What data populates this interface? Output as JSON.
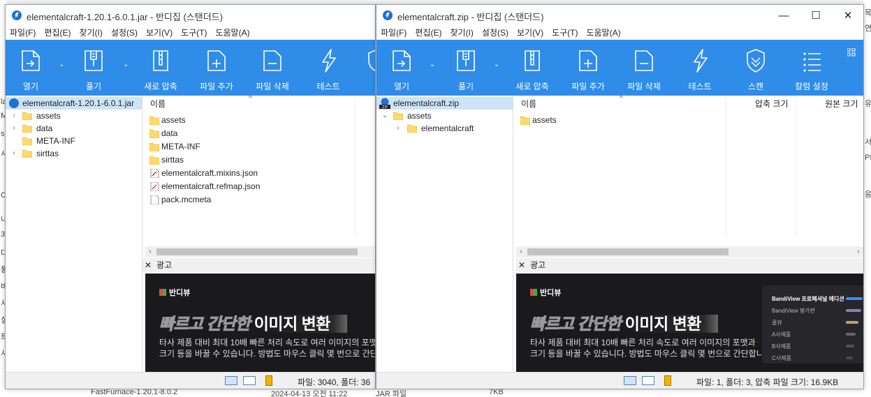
{
  "background": {
    "left_chars": [
      "la",
      "M",
      "s",
      "사",
      "Or",
      "내",
      "3",
      "다",
      "통",
      "바",
      "사",
      "실",
      "트",
      "사"
    ],
    "right_chars": [
      "목",
      "연",
      "유",
      "서",
      "PN",
      "응"
    ],
    "bottom_name": "FastFurnace-1.20.1-8.0.2",
    "bottom_date": "2024-04-13 오전 11:22",
    "bottom_type": "JAR 파일",
    "bottom_size": "7KB"
  },
  "win1": {
    "title": "elementalcraft-1.20.1-6.0.1.jar - 반디집 (스탠더드)",
    "menu": [
      "파일(F)",
      "편집(E)",
      "찾기(I)",
      "설정(S)",
      "보기(V)",
      "도구(T)",
      "도움말(A)"
    ],
    "toolbar": [
      "열기",
      "풀기",
      "새로 압축",
      "파일 추가",
      "파일 삭제",
      "테스트"
    ],
    "tree_root": "elementalcraft-1.20.1-6.0.1.jar",
    "tree": [
      "assets",
      "data",
      "META-INF",
      "sirttas"
    ],
    "col_name": "이름",
    "files": [
      {
        "name": "assets",
        "kind": "folder"
      },
      {
        "name": "data",
        "kind": "folder"
      },
      {
        "name": "META-INF",
        "kind": "folder"
      },
      {
        "name": "sirttas",
        "kind": "folder"
      },
      {
        "name": "elementalcraft.mixins.json",
        "kind": "json"
      },
      {
        "name": "elementalcraft.refmap.json",
        "kind": "json"
      },
      {
        "name": "pack.mcmeta",
        "kind": "file"
      }
    ],
    "ad_label": "광고",
    "status": "파일: 3040, 폴더: 36"
  },
  "win2": {
    "title": "elementalcraft.zip - 반디집 (스탠더드)",
    "controls": {
      "minimize": "—",
      "maximize": "☐",
      "close": "✕"
    },
    "menu": [
      "파일(F)",
      "편집(E)",
      "찾기(I)",
      "설정(S)",
      "보기(V)",
      "도구(T)",
      "도움말(A)"
    ],
    "toolbar": [
      "열기",
      "풀기",
      "새로 압축",
      "파일 추가",
      "파일 삭제",
      "테스트",
      "스캔",
      "칼럼 설정"
    ],
    "tree_root": "elementalcraft.zip",
    "tree_child": "assets",
    "tree_grandchild": "elementalcraft",
    "col_name": "이름",
    "col_packed": "압축 크기",
    "col_original": "원본 크기",
    "files": [
      {
        "name": "assets",
        "kind": "folder"
      }
    ],
    "ad_label": "광고",
    "status": "파일: 1, 폴더: 3, 압축 파일 크기: 16.9KB"
  },
  "ad": {
    "brand": "반디뷰",
    "headline_dim": "빠르고 간단한",
    "headline_bold": "이미지 변환",
    "desc_line1": "타사 제품 대비 최대 10배 빠른 처리 속도로 여러 이미지의 포맷과",
    "desc_line2": "크기 등을 바꿀 수 있습니다. 방법도 마우스 클릭 몇 번으로 간단합니다.",
    "panel_rows": [
      "BandiView 프로페셔널 에디션",
      "BandiView 평가판",
      "꿀뷰",
      "A사제품",
      "B사제품",
      "C사제품"
    ],
    "panel_levels": [
      1.0,
      0.9,
      0.75,
      0.6,
      0.5,
      0.4
    ],
    "panel_colors": [
      "#3b8cf0",
      "#8a7fb0",
      "#b8a470",
      "#666666",
      "#555555",
      "#4a4a4a"
    ]
  },
  "colors": {
    "toolbar": "#2f8ce8",
    "selection": "#cce4f7",
    "folder": "#ffd969"
  }
}
